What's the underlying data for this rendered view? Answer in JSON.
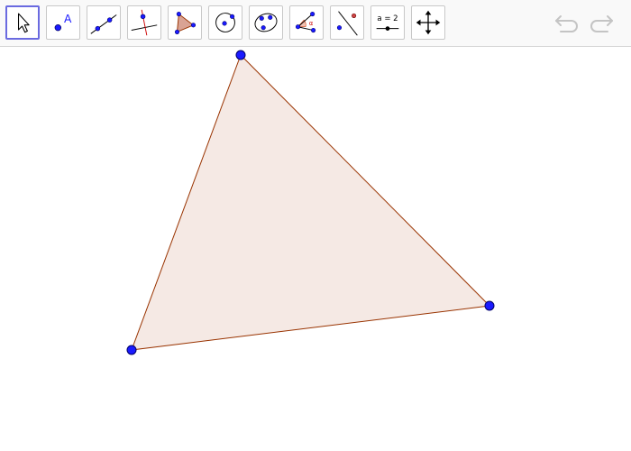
{
  "toolbar": {
    "tools": [
      {
        "name": "move-tool",
        "icon": "arrow-cursor-icon",
        "selected": true
      },
      {
        "name": "point-tool",
        "icon": "point-icon",
        "label": "A"
      },
      {
        "name": "line-tool",
        "icon": "line-through-two-points-icon"
      },
      {
        "name": "perpendicular-line-tool",
        "icon": "perpendicular-line-icon"
      },
      {
        "name": "polygon-tool",
        "icon": "polygon-icon"
      },
      {
        "name": "circle-tool",
        "icon": "circle-center-point-icon"
      },
      {
        "name": "conic-tool",
        "icon": "ellipse-icon"
      },
      {
        "name": "angle-tool",
        "icon": "angle-icon",
        "label": "α"
      },
      {
        "name": "reflect-tool",
        "icon": "reflect-about-line-icon"
      },
      {
        "name": "slider-tool",
        "icon": "slider-icon",
        "label": "a = 2"
      },
      {
        "name": "move-graphics-view-tool",
        "icon": "move-arrows-icon"
      }
    ],
    "undo_icon": "undo-icon",
    "redo_icon": "redo-icon"
  },
  "colors": {
    "polygon_fill": "#f5e9e4",
    "polygon_stroke": "#993300",
    "point_fill": "#1a1aff",
    "point_stroke": "#000066",
    "selected_border": "#6a6ae0"
  },
  "triangle": {
    "vertices": [
      {
        "name": "vertex-top"
      },
      {
        "name": "vertex-right"
      },
      {
        "name": "vertex-left"
      }
    ]
  }
}
